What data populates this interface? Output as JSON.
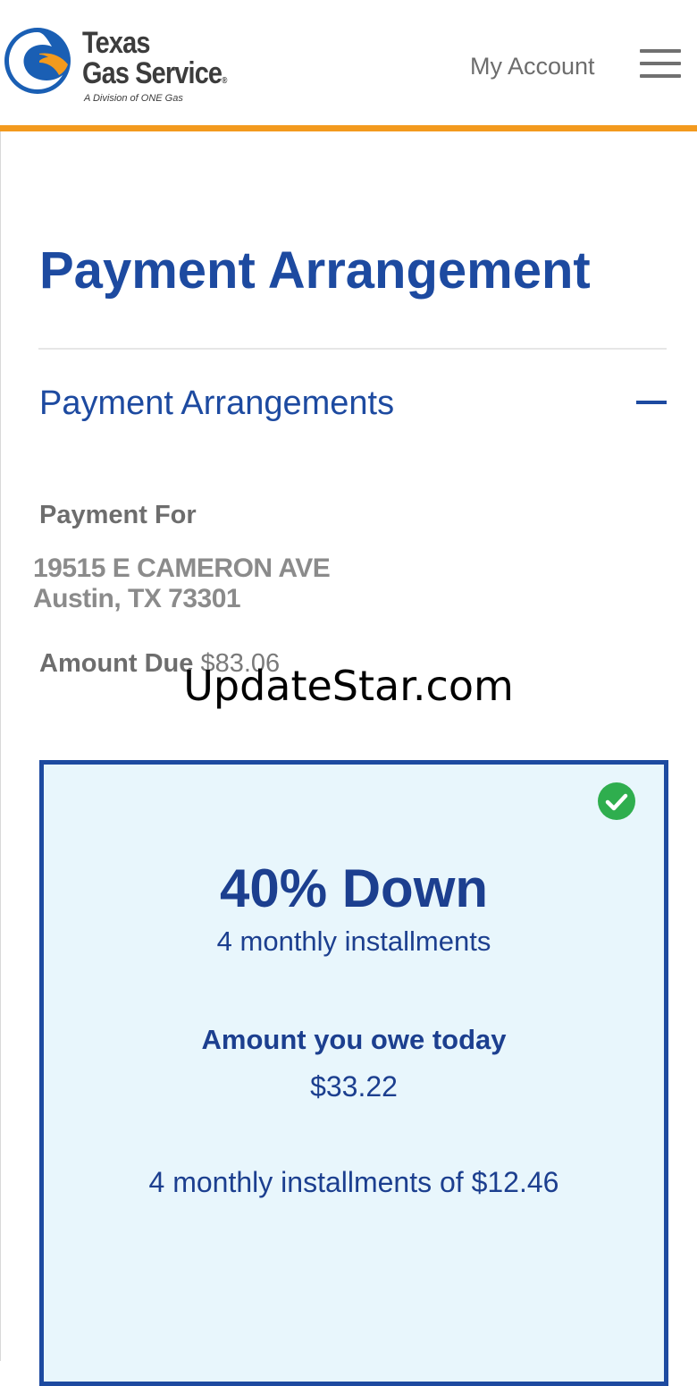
{
  "header": {
    "logo": {
      "line1": "Texas",
      "line2": "Gas Service",
      "registered": "®",
      "tagline": "A Division of ONE Gas"
    },
    "my_account_label": "My Account",
    "menu_icon": "hamburger-menu-icon"
  },
  "page": {
    "title": "Payment Arrangement"
  },
  "section": {
    "title": "Payment Arrangements",
    "toggle_icon": "minus-icon",
    "payment_for_label": "Payment For",
    "address_line1": "19515 E CAMERON AVE",
    "address_line2": "Austin, TX 73301",
    "amount_due_label": "Amount Due",
    "amount_due_value": "$83.06"
  },
  "watermark": "UpdateStar.com",
  "plan": {
    "selected": true,
    "check_icon": "check-circle-icon",
    "title": "40% Down",
    "subtitle": "4 monthly installments",
    "owe_today_label": "Amount you owe today",
    "owe_today_value": "$33.22",
    "installment_text": "4 monthly installments of $12.46"
  },
  "colors": {
    "brand_blue": "#1d4aa0",
    "accent_orange": "#f39a1e",
    "card_background": "#e8f6fc",
    "check_green": "#2fae4e"
  }
}
